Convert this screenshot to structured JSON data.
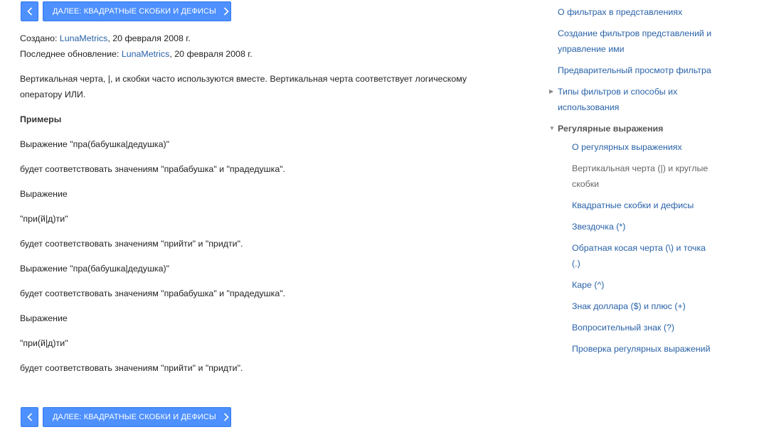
{
  "nav": {
    "next_label": "ДАЛЕЕ: КВАДРАТНЫЕ СКОБКИ И ДЕФИСЫ"
  },
  "meta": {
    "created_prefix": "Создано: ",
    "created_author": "LunaMetrics",
    "created_date": ", 20 февраля 2008 г.",
    "updated_prefix": "Последнее обновление: ",
    "updated_author": "LunaMetrics",
    "updated_date": ", 20 февраля 2008 г."
  },
  "article": {
    "intro_line1": "Вертикальная черта, |, и скобки часто используются вместе. Вертикальная черта соответствует логическому",
    "intro_line2": "оператору ИЛИ.",
    "heading": "Примеры",
    "paragraphs": [
      "Выражение \"пра(бабушка|дедушка)\"",
      "будет соответствовать значениям \"прабабушка\" и \"прадедушка\".",
      "Выражение",
      "\"при(й|д)ти\"",
      "будет соответствовать значениям \"прийти\" и \"придти\".",
      "Выражение \"пра(бабушка|дедушка)\"",
      "будет соответствовать значениям \"прабабушка\" и \"прадедушка\".",
      "Выражение",
      "\"при(й|д)ти\"",
      "будет соответствовать значениям \"прийти\" и \"придти\"."
    ]
  },
  "sidebar": {
    "items": [
      "О фильтрах в представлениях",
      "Создание фильтров представлений и",
      "управление ими",
      "Предварительный просмотр фильтра",
      "Типы фильтров и способы их",
      "использования"
    ],
    "section_title": "Регулярные выражения",
    "sub_items": [
      "О регулярных выражениях",
      "Вертикальная черта (|) и круглые",
      "скобки",
      "Квадратные скобки и дефисы",
      "Звездочка (*)",
      "Обратная косая черта (\\) и точка",
      "(.)",
      "Каре (^)",
      "Знак доллара ($) и плюс (+)",
      "Вопросительный знак (?)",
      "Проверка регулярных выражений"
    ]
  }
}
